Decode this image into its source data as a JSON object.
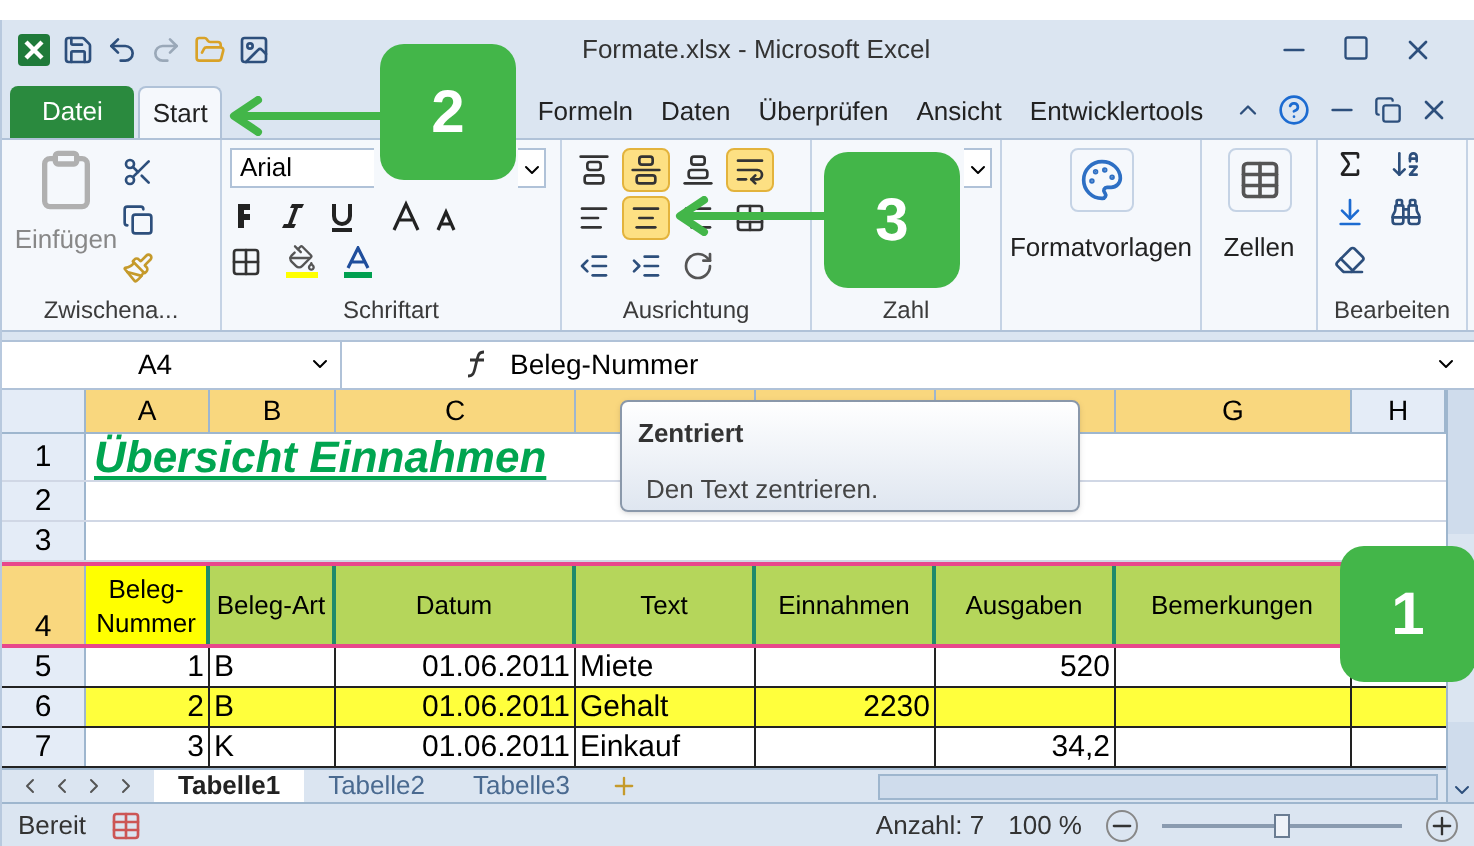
{
  "window": {
    "title": "Formate.xlsx - Microsoft Excel"
  },
  "tabs": [
    {
      "label": "Datei",
      "kind": "file",
      "selected": false
    },
    {
      "label": "Start",
      "kind": "tab",
      "selected": true
    },
    {
      "label": "Formeln",
      "kind": "tab",
      "selected": false
    },
    {
      "label": "Daten",
      "kind": "tab",
      "selected": false
    },
    {
      "label": "Überprüfen",
      "kind": "tab",
      "selected": false
    },
    {
      "label": "Ansicht",
      "kind": "tab",
      "selected": false
    },
    {
      "label": "Entwicklertools",
      "kind": "tab",
      "selected": false
    }
  ],
  "ribbon": {
    "paste_label": "Einfügen",
    "font_name": "Arial",
    "alignment_buttons": [
      {
        "selected": false
      },
      {
        "selected": true
      },
      {
        "selected": false
      },
      {
        "selected": true
      },
      {
        "selected": false
      },
      {
        "selected": true
      },
      {
        "selected": false
      },
      {
        "selected": false
      }
    ],
    "styles_label": "Formatvorlagen",
    "cells_label": "Zellen",
    "groups": [
      "Zwischena...",
      "Schriftart",
      "Ausrichtung",
      "Zahl",
      "Bearbeiten"
    ]
  },
  "formula_bar": {
    "name_box": "A4",
    "value": "Beleg-Nummer"
  },
  "columns": [
    {
      "label": "A",
      "selected": true
    },
    {
      "label": "B",
      "selected": true
    },
    {
      "label": "C",
      "selected": true
    },
    {
      "selected": true
    },
    {
      "selected": true
    },
    {
      "selected": true
    },
    {
      "label": "G",
      "selected": true
    },
    {
      "label": "H",
      "selected": false
    }
  ],
  "title_row": {
    "row": "1",
    "text": "Übersicht Einnahmen"
  },
  "empty_rows": [
    "2",
    "3"
  ],
  "header_row": {
    "row": "4",
    "selected": true,
    "cells": [
      "Beleg-Nummer",
      "Beleg-Art",
      "Datum",
      "Text",
      "Einnahmen",
      "Ausgaben",
      "Bemerkungen"
    ]
  },
  "rows": [
    {
      "row": "5",
      "highlighted": false,
      "cells": [
        "1",
        "B",
        "01.06.2011",
        "Miete",
        "",
        "520",
        ""
      ]
    },
    {
      "row": "6",
      "highlighted": true,
      "cells": [
        "2",
        "B",
        "01.06.2011",
        "Gehalt",
        "2230",
        "",
        ""
      ]
    },
    {
      "row": "7",
      "highlighted": false,
      "cells": [
        "3",
        "K",
        "01.06.2011",
        "Einkauf",
        "",
        "34,2",
        ""
      ]
    }
  ],
  "sheet_tabs": [
    {
      "label": "Tabelle1",
      "selected": true
    },
    {
      "label": "Tabelle2",
      "selected": false
    },
    {
      "label": "Tabelle3",
      "selected": false
    }
  ],
  "status_bar": {
    "mode": "Bereit",
    "count": "Anzahl: 7",
    "zoom": "100 %",
    "zoom_slider": {
      "level": 0.5
    }
  },
  "tooltip": {
    "title": "Zentriert",
    "text": "Den Text zentrieren."
  },
  "callouts": [
    {
      "number": "2"
    },
    {
      "number": "3"
    },
    {
      "number": "1"
    }
  ]
}
